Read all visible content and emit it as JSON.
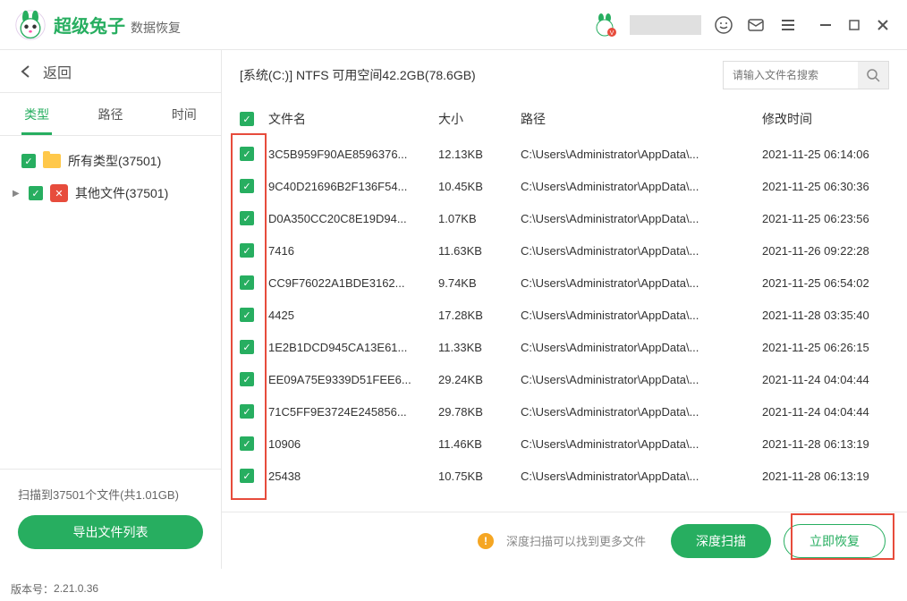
{
  "header": {
    "logo_main": "超级兔子",
    "logo_sub": "数据恢复"
  },
  "sidebar": {
    "back_label": "返回",
    "tabs": [
      {
        "label": "类型",
        "active": true
      },
      {
        "label": "路径",
        "active": false
      },
      {
        "label": "时间",
        "active": false
      }
    ],
    "tree": [
      {
        "label": "所有类型(37501)",
        "icon": "folder",
        "indent": 0
      },
      {
        "label": "其他文件(37501)",
        "icon": "other",
        "indent": 1
      }
    ],
    "scan_status": "扫描到37501个文件(共1.01GB)",
    "export_label": "导出文件列表"
  },
  "content": {
    "path_info": "[系统(C:)] NTFS 可用空间42.2GB(78.6GB)",
    "search_placeholder": "请输入文件名搜索",
    "columns": {
      "name": "文件名",
      "size": "大小",
      "path": "路径",
      "time": "修改时间"
    },
    "rows": [
      {
        "name": "3C5B959F90AE8596376...",
        "size": "12.13KB",
        "path": "C:\\Users\\Administrator\\AppData\\...",
        "time": "2021-11-25 06:14:06"
      },
      {
        "name": "9C40D21696B2F136F54...",
        "size": "10.45KB",
        "path": "C:\\Users\\Administrator\\AppData\\...",
        "time": "2021-11-25 06:30:36"
      },
      {
        "name": "D0A350CC20C8E19D94...",
        "size": "1.07KB",
        "path": "C:\\Users\\Administrator\\AppData\\...",
        "time": "2021-11-25 06:23:56"
      },
      {
        "name": "7416",
        "size": "11.63KB",
        "path": "C:\\Users\\Administrator\\AppData\\...",
        "time": "2021-11-26 09:22:28"
      },
      {
        "name": "CC9F76022A1BDE3162...",
        "size": "9.74KB",
        "path": "C:\\Users\\Administrator\\AppData\\...",
        "time": "2021-11-25 06:54:02"
      },
      {
        "name": "4425",
        "size": "17.28KB",
        "path": "C:\\Users\\Administrator\\AppData\\...",
        "time": "2021-11-28 03:35:40"
      },
      {
        "name": "1E2B1DCD945CA13E61...",
        "size": "11.33KB",
        "path": "C:\\Users\\Administrator\\AppData\\...",
        "time": "2021-11-25 06:26:15"
      },
      {
        "name": "EE09A75E9339D51FEE6...",
        "size": "29.24KB",
        "path": "C:\\Users\\Administrator\\AppData\\...",
        "time": "2021-11-24 04:04:44"
      },
      {
        "name": "71C5FF9E3724E245856...",
        "size": "29.78KB",
        "path": "C:\\Users\\Administrator\\AppData\\...",
        "time": "2021-11-24 04:04:44"
      },
      {
        "name": "10906",
        "size": "11.46KB",
        "path": "C:\\Users\\Administrator\\AppData\\...",
        "time": "2021-11-28 06:13:19"
      },
      {
        "name": "25438",
        "size": "10.75KB",
        "path": "C:\\Users\\Administrator\\AppData\\...",
        "time": "2021-11-28 06:13:19"
      }
    ],
    "footer": {
      "warn": "深度扫描可以找到更多文件",
      "deep_scan": "深度扫描",
      "recover": "立即恢复"
    }
  },
  "version": {
    "label": "版本号：",
    "value": "2.21.0.36"
  }
}
